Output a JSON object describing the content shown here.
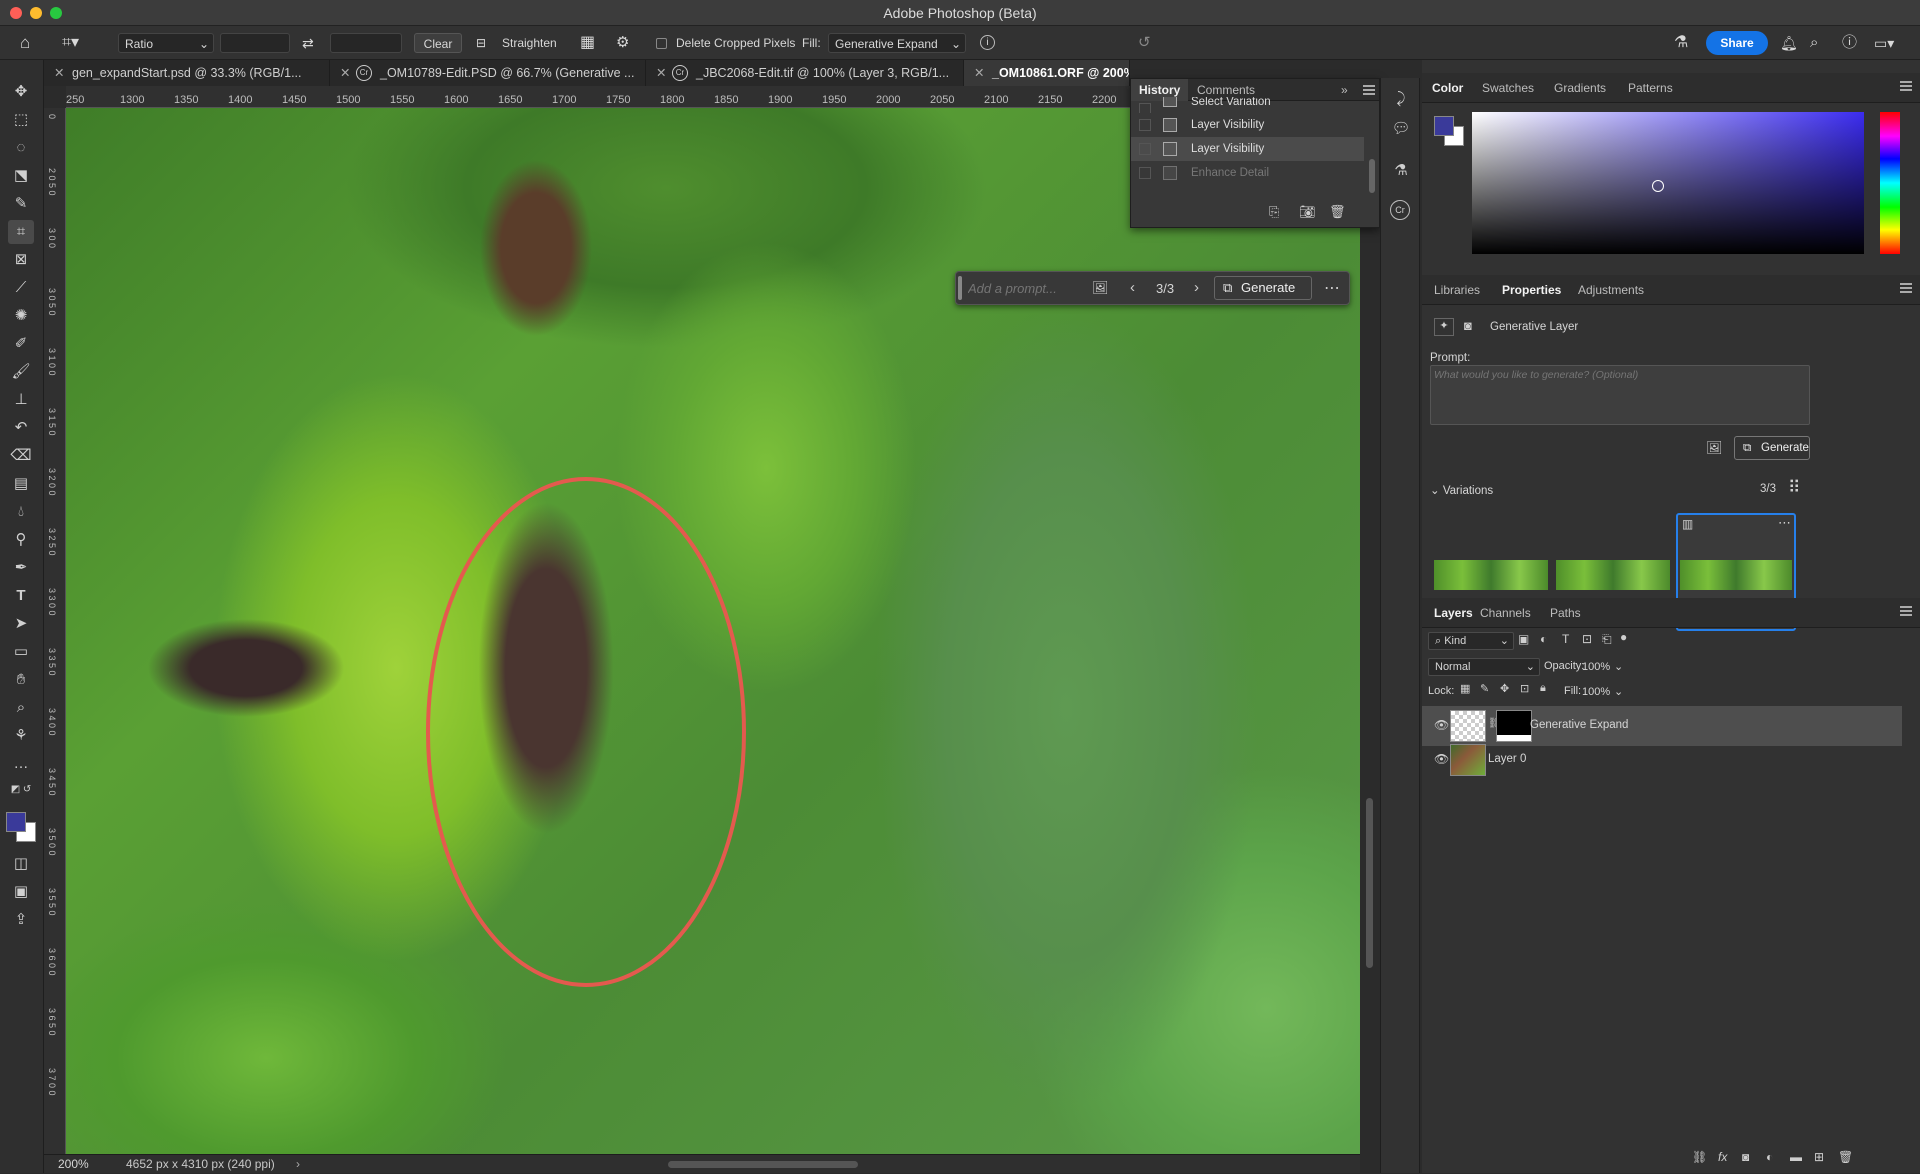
{
  "window": {
    "title": "Adobe Photoshop (Beta)"
  },
  "options_bar": {
    "ratio_label": "Ratio",
    "clear_label": "Clear",
    "straighten_label": "Straighten",
    "delete_cropped_label": "Delete Cropped Pixels",
    "fill_label": "Fill:",
    "fill_value": "Generative Expand",
    "share_label": "Share"
  },
  "tabs": [
    {
      "label": "gen_expandStart.psd @ 33.3% (RGB/1...",
      "active": false
    },
    {
      "label": "_OM10789-Edit.PSD @ 66.7% (Generative ...",
      "active": false
    },
    {
      "label": "_JBC2068-Edit.tif @ 100% (Layer 3, RGB/1...",
      "active": false
    },
    {
      "label": "_OM10861.ORF @ 200%",
      "active": true
    }
  ],
  "ruler": {
    "h_ticks": [
      "250",
      "1300",
      "1350",
      "1400",
      "1450",
      "1500",
      "1550",
      "1600",
      "1650",
      "1700",
      "1750",
      "1800",
      "1850",
      "1900",
      "1950",
      "2000",
      "2050",
      "2100",
      "2150",
      "2200"
    ]
  },
  "status": {
    "zoom": "200%",
    "doc_info": "4652 px x 4310 px (240 ppi)"
  },
  "history": {
    "tabs": [
      "History",
      "Comments"
    ],
    "items": [
      {
        "label": "Select Variation",
        "dimmed": false,
        "active": false
      },
      {
        "label": "Layer Visibility",
        "dimmed": false,
        "active": false
      },
      {
        "label": "Layer Visibility",
        "dimmed": false,
        "active": true
      },
      {
        "label": "Enhance Detail",
        "dimmed": true,
        "active": false
      }
    ]
  },
  "taskbar": {
    "prompt_placeholder": "Add a prompt...",
    "counter": "3/3",
    "generate_label": "Generate"
  },
  "color_panel": {
    "tabs": [
      "Color",
      "Swatches",
      "Gradients",
      "Patterns"
    ],
    "foreground": "#3a3a9a",
    "background": "#ffffff"
  },
  "properties_panel": {
    "tabs": [
      "Libraries",
      "Properties",
      "Adjustments"
    ],
    "layer_type": "Generative Layer",
    "prompt_label": "Prompt:",
    "prompt_placeholder": "What would you like to generate? (Optional)",
    "generate_label": "Generate",
    "variations_label": "Variations",
    "variations_count": "3/3"
  },
  "layers_panel": {
    "tabs": [
      "Layers",
      "Channels",
      "Paths"
    ],
    "filter_kind": "Kind",
    "blend_mode": "Normal",
    "opacity_label": "Opacity:",
    "opacity_value": "100%",
    "lock_label": "Lock:",
    "fill_label": "Fill:",
    "fill_value": "100%",
    "layers": [
      {
        "name": "Generative Expand",
        "selected": true
      },
      {
        "name": "Layer 0",
        "selected": false
      }
    ]
  }
}
